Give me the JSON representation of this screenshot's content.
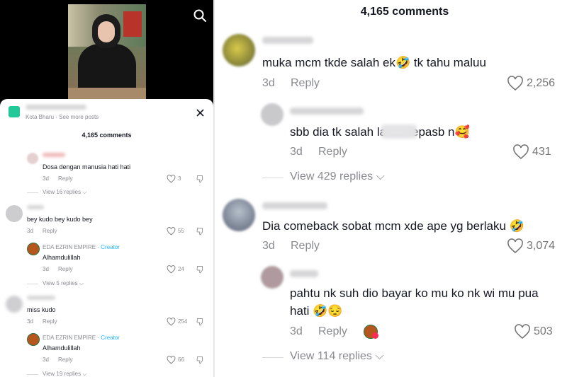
{
  "left": {
    "location": "Kota Bharu · See more posts",
    "comments_title": "4,165 comments",
    "comments": [
      {
        "text": "Dosa dengan manusia hati hati",
        "date": "3d",
        "reply": "Reply",
        "likes": "3",
        "view_replies": "View 16 replies"
      },
      {
        "text": "bey kudo bey kudo bey",
        "date": "3d",
        "reply": "Reply",
        "likes": "55",
        "reply_author": "EDA EZRIN EMPIRE",
        "reply_badge": "· Creator",
        "reply_text": "Alhamdulillah",
        "reply_date": "3d",
        "reply_reply": "Reply",
        "reply_likes": "24",
        "view_replies": "View 5 replies"
      },
      {
        "text": "miss kudo",
        "date": "3d",
        "reply": "Reply",
        "likes": "254",
        "reply_author": "EDA EZRIN EMPIRE",
        "reply_badge": "· Creator",
        "reply_text": "Alhamdulillah",
        "reply_date": "3d",
        "reply_reply": "Reply",
        "reply_likes": "66",
        "view_replies": "View 19 replies"
      }
    ]
  },
  "right": {
    "comments_title": "4,165 comments",
    "items": [
      {
        "text": "muka mcm tkde salah ek🤣  tk tahu maluu",
        "date": "3d",
        "reply": "Reply",
        "likes": "2,256"
      },
      {
        "text": "sbb dia tk salah la dia lepasb      n🥰",
        "date": "3d",
        "reply": "Reply",
        "likes": "431",
        "view_replies": "View 429 replies"
      },
      {
        "text": "Dia comeback sobat mcm xde ape yg berlaku 🤣",
        "date": "3d",
        "reply": "Reply",
        "likes": "3,074"
      },
      {
        "text_line1": "pahtu nk suh dio bayar ko mu ko nk wi mu pua",
        "text_line2": "hati 🤣😔",
        "date": "3d",
        "reply": "Reply",
        "likes": "503",
        "view_replies": "View 114 replies"
      }
    ]
  },
  "icons": {
    "search": "search-icon",
    "close": "close-icon",
    "heart": "heart-icon",
    "dislike": "dislike-icon",
    "chevron": "chevron-down-icon"
  }
}
